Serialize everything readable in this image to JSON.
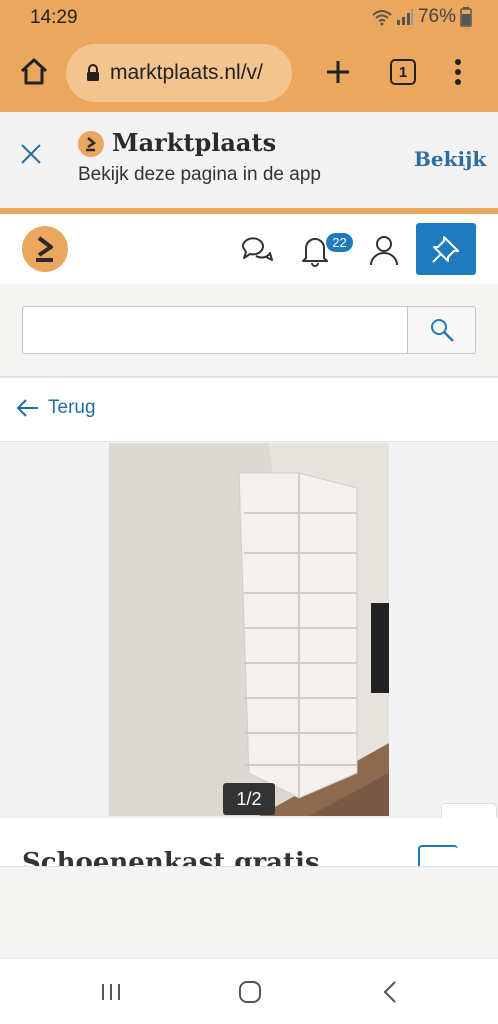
{
  "status_bar": {
    "time": "14:29",
    "battery": "76%",
    "icons": [
      "wifi-icon",
      "signal-icon",
      "battery-icon"
    ]
  },
  "browser": {
    "url": "marktplaats.nl/v/",
    "tab_count": "1",
    "icons": [
      "home-icon",
      "lock-icon",
      "plus-icon",
      "tabs-icon",
      "more-vert-icon"
    ]
  },
  "app_banner": {
    "title": "Marktplaats",
    "subtitle": "Bekijk deze pagina in de app",
    "action": "Bekijk"
  },
  "header": {
    "notification_count": "22",
    "icons": [
      "marktplaats-logo",
      "chat-icon",
      "bell-icon",
      "user-icon",
      "pin-icon"
    ]
  },
  "search": {
    "value": "",
    "placeholder": ""
  },
  "back": {
    "label": "Terug"
  },
  "gallery": {
    "counter": "1/2"
  },
  "listing": {
    "title": "Schoenenkast gratis"
  },
  "colors": {
    "brand_orange": "#eca75e",
    "brand_blue": "#1f7bbd",
    "link_blue": "#1f6fa6"
  }
}
